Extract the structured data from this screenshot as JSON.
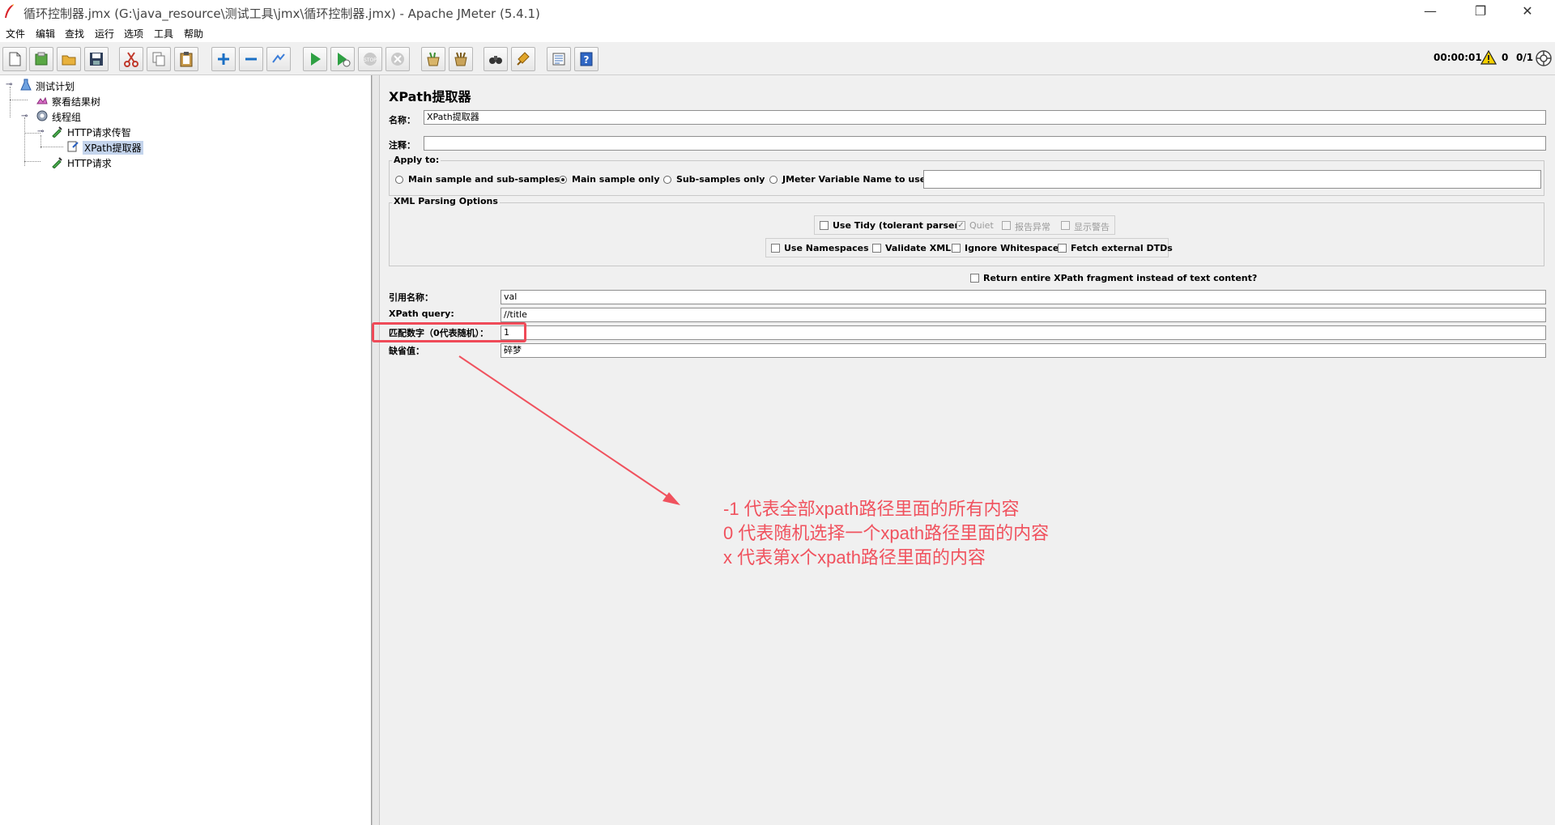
{
  "window": {
    "title": "循环控制器.jmx (G:\\java_resource\\测试工具\\jmx\\循环控制器.jmx) - Apache JMeter (5.4.1)",
    "minimize_glyph": "—",
    "restore_glyph": "❐",
    "close_glyph": "✕"
  },
  "menu": [
    "文件",
    "编辑",
    "查找",
    "运行",
    "选项",
    "工具",
    "帮助"
  ],
  "toolbar": {
    "buttons": [
      "new-icon",
      "templates-icon",
      "open-icon",
      "save-icon",
      "cut-icon",
      "copy-icon",
      "paste-icon",
      "expand-icon",
      "collapse-icon",
      "toggle-icon",
      "start-icon",
      "start-no-pause-icon",
      "stop-icon",
      "shutdown-icon",
      "clear-icon",
      "clear-all-icon",
      "search-icon",
      "reset-search-icon",
      "function-helper-icon",
      "help-icon"
    ],
    "timer": "00:00:01",
    "error_count": "0",
    "threads": "0/1"
  },
  "tree": {
    "nodes": [
      {
        "label": "测试计划"
      },
      {
        "label": "察看结果树"
      },
      {
        "label": "线程组"
      },
      {
        "label": "HTTP请求传智"
      },
      {
        "label": "XPath提取器"
      },
      {
        "label": "HTTP请求"
      }
    ]
  },
  "panel": {
    "title": "XPath提取器",
    "name_label": "名称：",
    "name_value": "XPath提取器",
    "comment_label": "注释：",
    "comment_value": "",
    "apply_to": {
      "title": "Apply to:",
      "options": [
        "Main sample and sub-samples",
        "Main sample only",
        "Sub-samples only",
        "JMeter Variable Name to use"
      ],
      "selected": "Main sample only",
      "variable_value": ""
    },
    "xml_parsing": {
      "title": "XML Parsing Options",
      "use_tidy": "Use Tidy (tolerant parser)",
      "quiet": "Quiet",
      "report_errors": "报告异常",
      "show_warnings": "显示警告",
      "use_namespaces": "Use Namespaces",
      "validate_xml": "Validate XML",
      "ignore_whitespace": "Ignore Whitespace",
      "fetch_dtds": "Fetch external DTDs"
    },
    "return_fragment": "Return entire XPath fragment instead of text content?",
    "ref_name_label": "引用名称：",
    "ref_name_value": "val",
    "xpath_label": "XPath query:",
    "xpath_value": "//title",
    "match_label": "匹配数字（0代表随机）：",
    "match_value": "1",
    "default_label": "缺省值：",
    "default_value": "碎梦"
  },
  "annotation": {
    "lines": [
      "-1 代表全部xpath路径里面的所有内容",
      "0 代表随机选择一个xpath路径里面的内容",
      "x 代表第x个xpath路径里面的内容"
    ],
    "color": "#f0525e"
  }
}
